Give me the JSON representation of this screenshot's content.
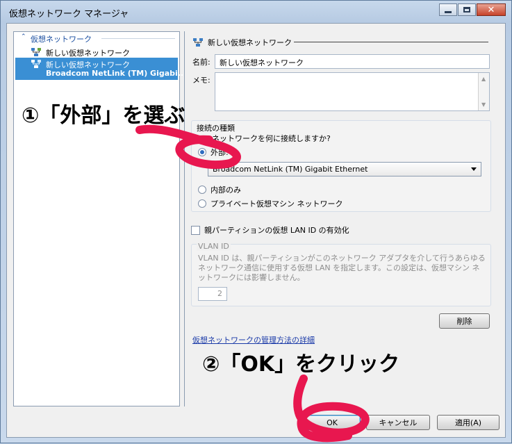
{
  "window": {
    "title": "仮想ネットワーク マネージャ"
  },
  "tree": {
    "header": "仮想ネットワーク",
    "items": [
      {
        "label": "新しい仮想ネットワーク"
      },
      {
        "label": "新しい仮想ネットワーク",
        "sub": "Broadcom NetLink (TM) Gigabi..."
      }
    ]
  },
  "detail": {
    "section_title": "新しい仮想ネットワーク",
    "name_label": "名前:",
    "name_value": "新しい仮想ネットワーク",
    "memo_label": "メモ:",
    "memo_value": "",
    "connection_group_title": "接続の種類",
    "connection_question": "このネットワークを何に接続しますか?",
    "options": [
      {
        "label": "外部:",
        "selected": true
      },
      {
        "label": "内部のみ",
        "selected": false
      },
      {
        "label": "プライベート仮想マシン ネットワーク",
        "selected": false
      }
    ],
    "adapter_selected": "Broadcom NetLink (TM) Gigabit Ethernet",
    "vlan_checkbox": "親パーティションの仮想 LAN ID の有効化",
    "vlan_checked": false,
    "vlan_group_title": "VLAN ID",
    "vlan_desc": "VLAN ID は、親パーティションがこのネットワーク アダプタを介して行うあらゆるネットワーク通信に使用する仮想 LAN を指定します。この設定は、仮想マシン ネットワークには影響しません。",
    "vlan_value": "2",
    "delete_button": "削除",
    "help_link": "仮想ネットワークの管理方法の詳細"
  },
  "footer": {
    "ok": "OK",
    "cancel": "キャンセル",
    "apply": "適用(A)"
  },
  "annotations": {
    "step1": "①「外部」を選ぶ",
    "step2": "②「OK」をクリック"
  },
  "colors": {
    "annotation_stroke": "#e8174f",
    "selection": "#3a8fd4"
  }
}
